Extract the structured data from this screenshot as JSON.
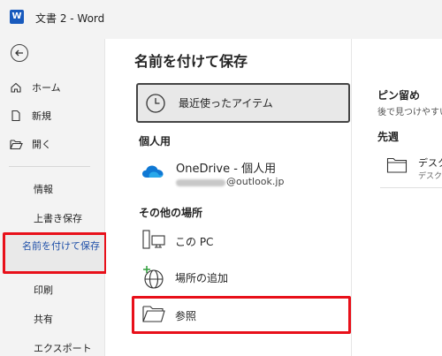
{
  "window": {
    "title": "文書 2  -  Word",
    "logo_letter": "W"
  },
  "sidebar": {
    "nav_main": [
      {
        "label": "ホーム",
        "icon": "home-icon"
      },
      {
        "label": "新規",
        "icon": "new-document-icon"
      },
      {
        "label": "開く",
        "icon": "open-folder-icon"
      }
    ],
    "nav_sub": [
      "情報",
      "上書き保存",
      "印刷",
      "共有",
      "エクスポート"
    ],
    "selected": "名前を付けて保存"
  },
  "main": {
    "heading": "名前を付けて保存",
    "recent": "最近使ったアイテム",
    "personal_label": "個人用",
    "onedrive_title": "OneDrive - 個人用",
    "onedrive_email": "@outlook.jp",
    "other_label": "その他の場所",
    "this_pc": "この PC",
    "add_place": "場所の追加",
    "browse": "参照"
  },
  "right_panel": {
    "pinned_title": "ピン留め",
    "pinned_sub": "後で見つけやすい",
    "last_week": "先週",
    "folder_name": "デスク",
    "folder_path": "デスク"
  },
  "colors": {
    "accent_blue": "#1e4fa8",
    "highlight_red": "#e8101a",
    "word_blue": "#185abd"
  }
}
